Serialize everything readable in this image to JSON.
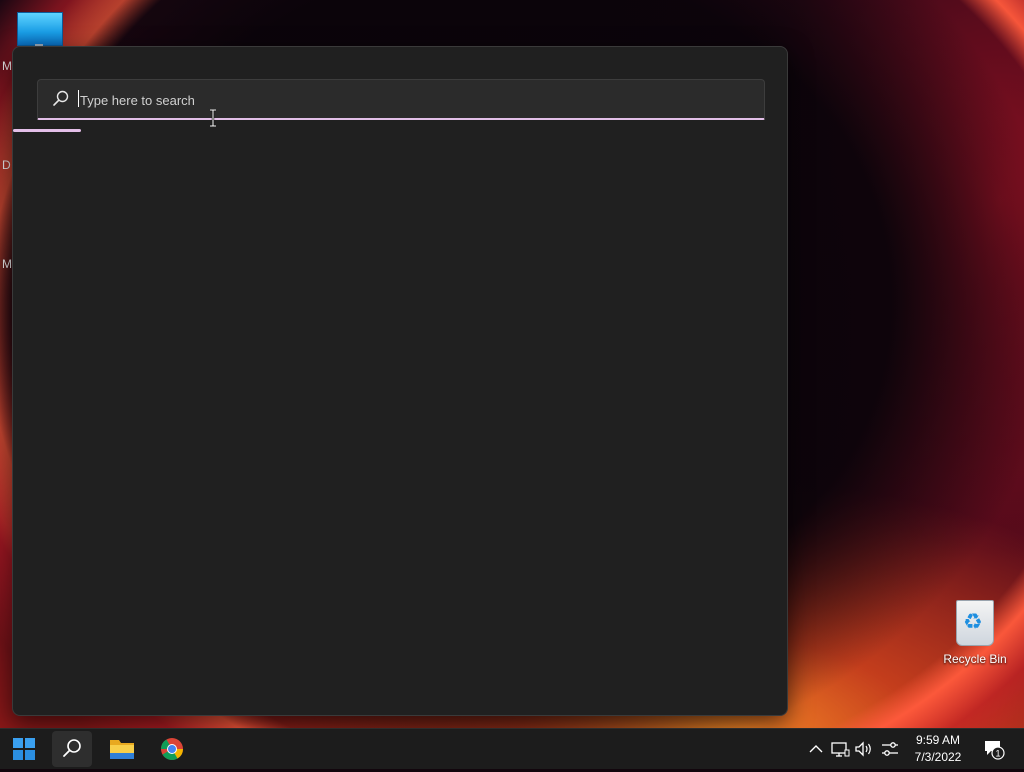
{
  "desktop": {
    "left_letters": [
      "M",
      "D",
      "M"
    ],
    "recycle_bin_label": "Recycle Bin"
  },
  "search": {
    "placeholder": "Type here to search",
    "accent_color": "#e3bfe8"
  },
  "taskbar": {
    "apps": [
      {
        "name": "Start",
        "icon": "windows-start-icon"
      },
      {
        "name": "Search",
        "icon": "search-icon",
        "active": true
      },
      {
        "name": "File Explorer",
        "icon": "folder-icon"
      },
      {
        "name": "Google Chrome",
        "icon": "chrome-icon"
      }
    ],
    "tray": {
      "time": "9:59 AM",
      "date": "7/3/2022",
      "notification_count": "1"
    }
  }
}
